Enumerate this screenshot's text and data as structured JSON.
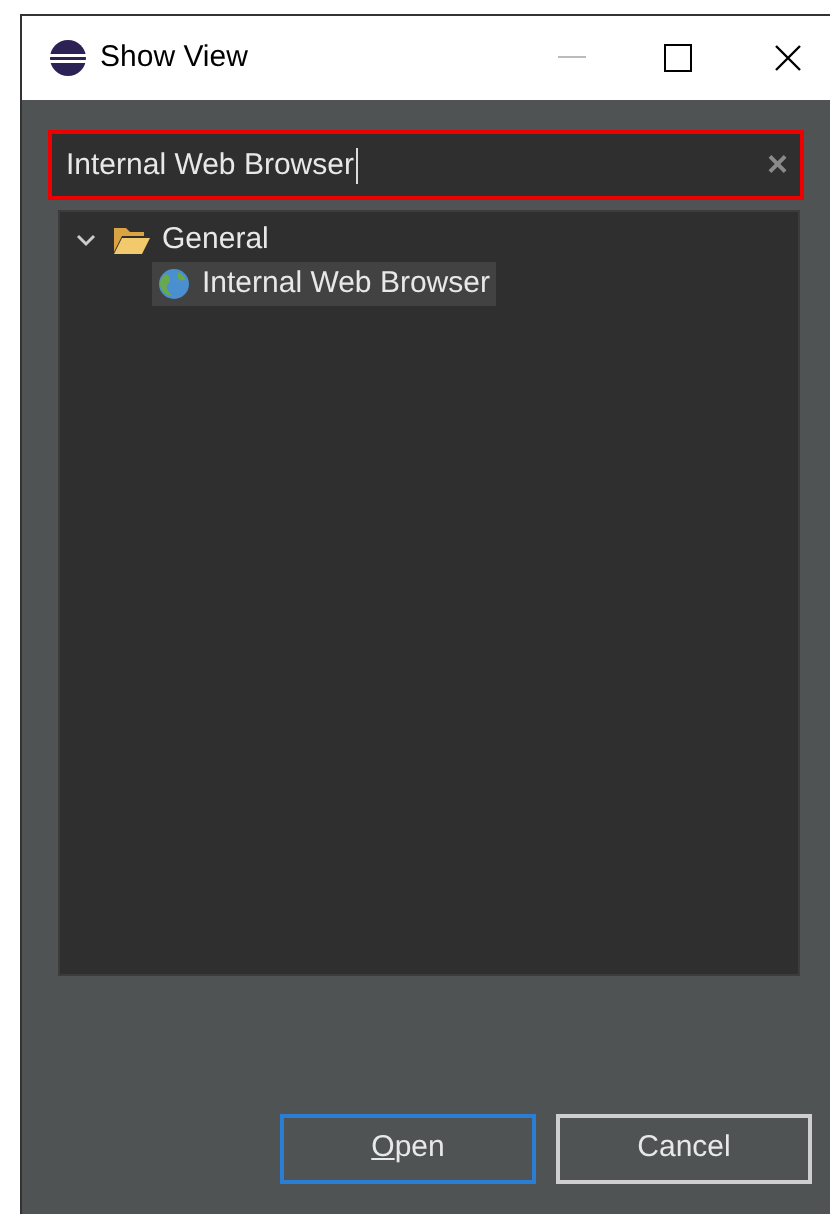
{
  "window": {
    "title": "Show View"
  },
  "filter": {
    "value": "Internal Web Browser",
    "clear": "×"
  },
  "tree": [
    {
      "label": "General",
      "kind": "folder",
      "expanded": true,
      "selected": false,
      "children": [
        {
          "label": "Internal Web Browser",
          "kind": "view",
          "selected": true
        }
      ]
    }
  ],
  "buttons": [
    {
      "label": "Open",
      "default": true
    },
    {
      "label": "Cancel",
      "default": false
    }
  ]
}
